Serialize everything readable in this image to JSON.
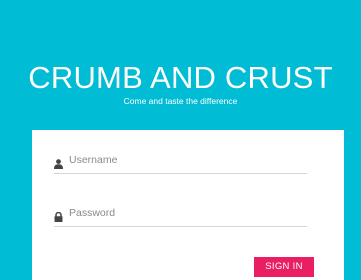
{
  "brand": {
    "title": "CRUMB AND CRUST",
    "tagline": "Come and taste the difference"
  },
  "login": {
    "username_placeholder": "Username",
    "username_value": "",
    "password_placeholder": "Password",
    "password_value": "",
    "signin_label": "SIGN IN"
  },
  "icons": {
    "username": "user-icon",
    "password": "lock-icon"
  },
  "colors": {
    "background": "#00bcd4",
    "card": "#ffffff",
    "accent": "#e91e63"
  }
}
